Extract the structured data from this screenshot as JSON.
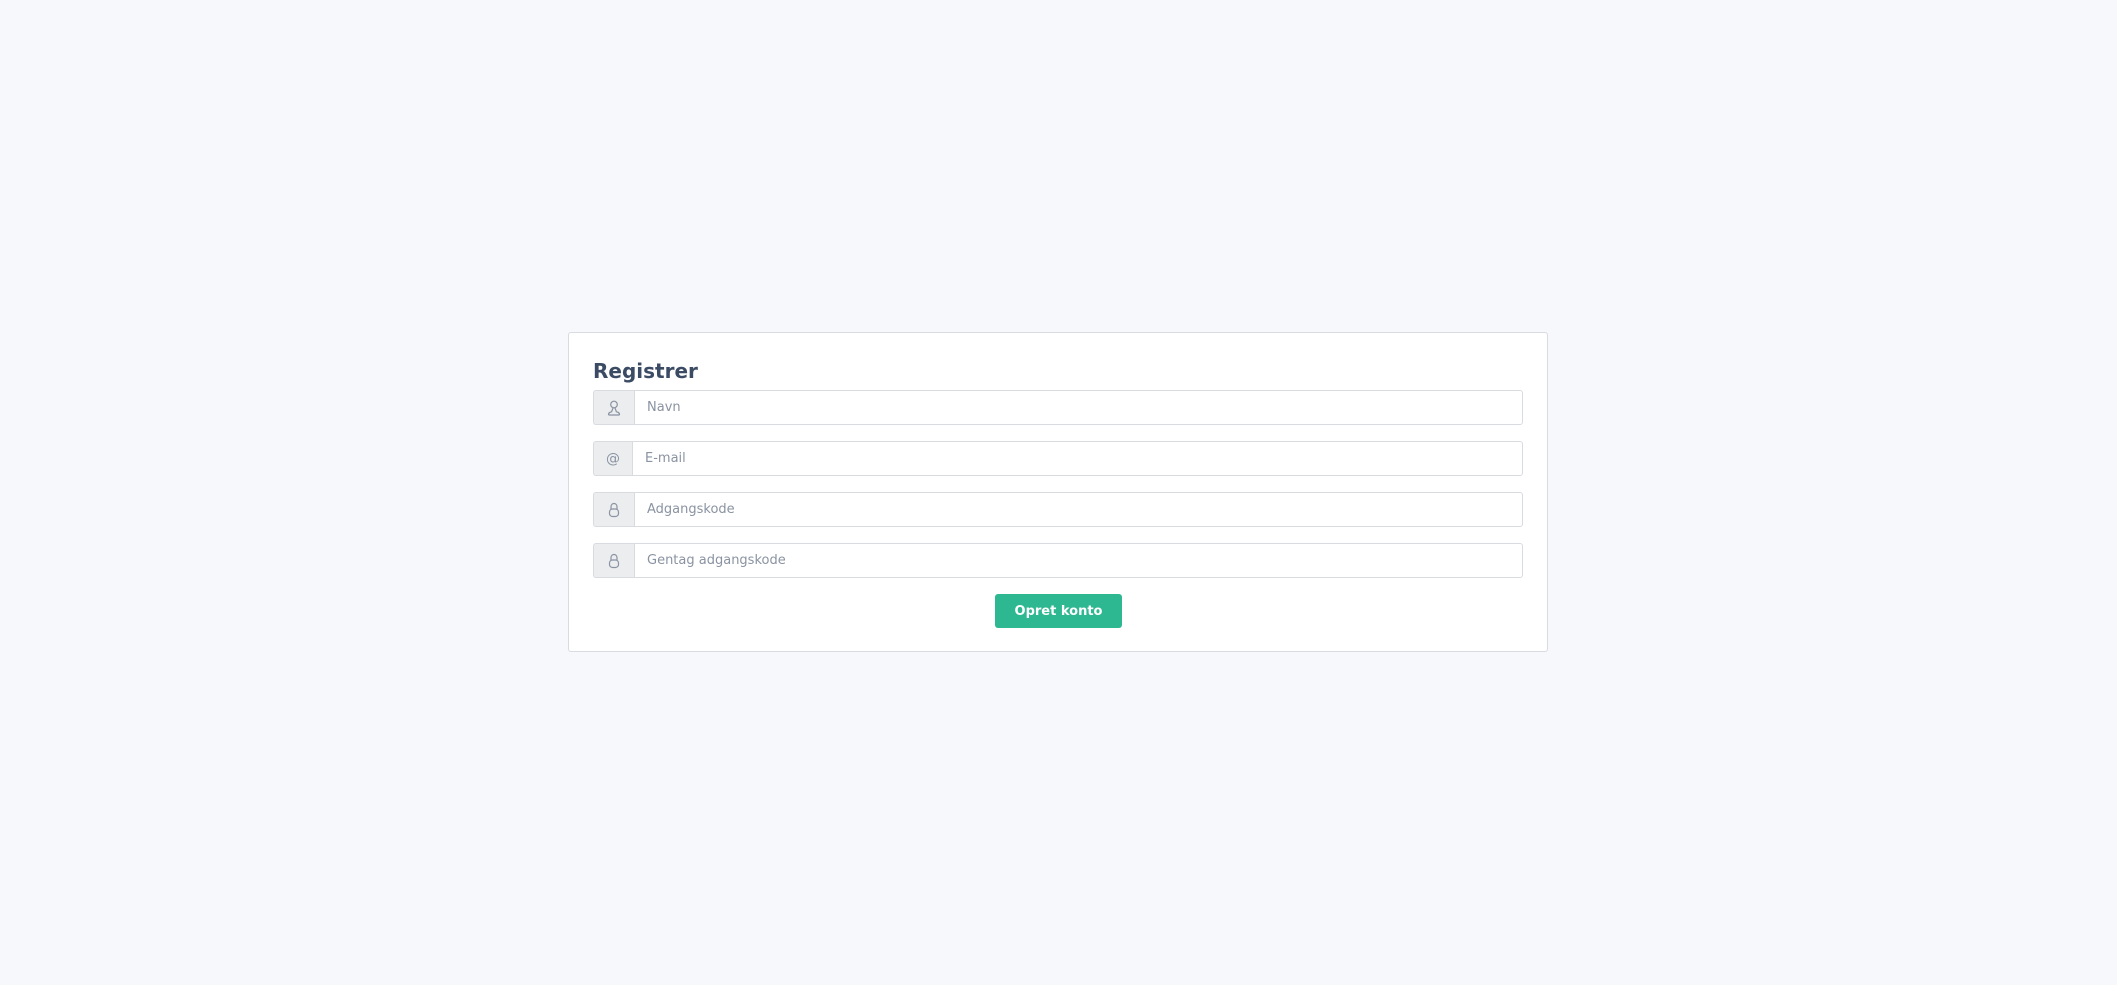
{
  "form": {
    "title": "Registrer",
    "fields": [
      {
        "icon": "user-icon",
        "value": "",
        "placeholder": "Navn",
        "type": "text"
      },
      {
        "icon": "at-icon",
        "icon_text": "@",
        "value": "",
        "placeholder": "E-mail",
        "type": "email"
      },
      {
        "icon": "lock-icon",
        "value": "",
        "placeholder": "Adgangskode",
        "type": "password"
      },
      {
        "icon": "lock-icon",
        "value": "",
        "placeholder": "Gentag adgangskode",
        "type": "password"
      }
    ],
    "submit_label": "Opret konto"
  },
  "colors": {
    "background": "#f7f8fb",
    "card": "#ffffff",
    "title": "#3c4b64",
    "accent": "#2eb891",
    "border": "#d8dbe0",
    "addon": "#ebedef"
  }
}
